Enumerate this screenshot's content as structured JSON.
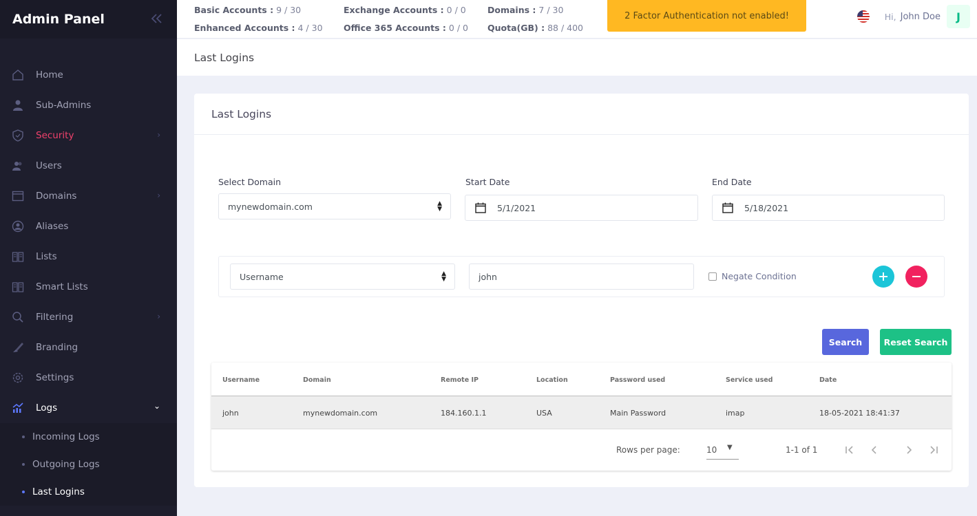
{
  "sidebar": {
    "title": "Admin Panel",
    "items": [
      {
        "label": "Home"
      },
      {
        "label": "Sub-Admins"
      },
      {
        "label": "Security"
      },
      {
        "label": "Users"
      },
      {
        "label": "Domains"
      },
      {
        "label": "Aliases"
      },
      {
        "label": "Lists"
      },
      {
        "label": "Smart Lists"
      },
      {
        "label": "Filtering"
      },
      {
        "label": "Branding"
      },
      {
        "label": "Settings"
      },
      {
        "label": "Logs"
      }
    ],
    "logs_submenu": [
      {
        "label": "Incoming Logs"
      },
      {
        "label": "Outgoing Logs"
      },
      {
        "label": "Last Logins"
      }
    ]
  },
  "header": {
    "stats": {
      "basic_label": "Basic Accounts :",
      "basic_value": "9 / 30",
      "enhanced_label": "Enhanced Accounts :",
      "enhanced_value": "4 / 30",
      "exchange_label": "Exchange Accounts :",
      "exchange_value": "0 / 0",
      "o365_label": "Office 365 Accounts :",
      "o365_value": "0 / 0",
      "domains_label": "Domains :",
      "domains_value": "7 / 30",
      "quota_label": "Quota(GB) :",
      "quota_value": "88 / 400"
    },
    "alert": "2 Factor Authentication not enabled!",
    "greeting": "Hi,",
    "user_name": "John Doe",
    "avatar_letter": "J"
  },
  "subheader": {
    "title": "Last Logins"
  },
  "card": {
    "title": "Last Logins",
    "select_domain_label": "Select Domain",
    "select_domain_value": "mynewdomain.com",
    "start_date_label": "Start Date",
    "start_date_value": "5/1/2021",
    "end_date_label": "End Date",
    "end_date_value": "5/18/2021",
    "condition_field": "Username",
    "condition_value": "john",
    "negate_label": "Negate Condition",
    "search_label": "Search",
    "reset_label": "Reset Search"
  },
  "table": {
    "columns": [
      "Username",
      "Domain",
      "Remote IP",
      "Location",
      "Password used",
      "Service used",
      "Date"
    ],
    "rows": [
      [
        "john",
        "mynewdomain.com",
        "184.160.1.1",
        "USA",
        "Main Password",
        "imap",
        "18-05-2021 18:41:37"
      ]
    ],
    "rows_per_page_label": "Rows per page:",
    "rows_per_page_value": "10",
    "range_text": "1-1 of 1"
  },
  "colors": {
    "sidebar_bg": "#1e1e2d",
    "accent_active": "#f1416c",
    "alert_bg": "#ffb822",
    "search_btn": "#5867dd",
    "reset_btn": "#1dc186",
    "add_btn": "#1bc5d8",
    "remove_btn": "#f1225f"
  }
}
